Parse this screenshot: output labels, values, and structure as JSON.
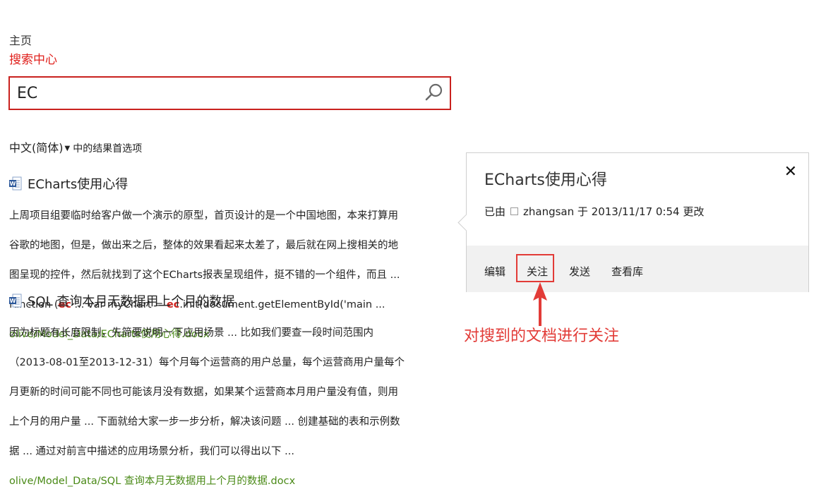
{
  "breadcrumb": {
    "home": "主页",
    "current": "搜索中心"
  },
  "search": {
    "value": "EC"
  },
  "language": {
    "selected": "中文(简体)",
    "suffix": "中的结果首选项"
  },
  "results": [
    {
      "title": "ECharts使用心得",
      "snippet_lines": [
        "上周项目组要临时给客户做一个演示的原型，首页设计的是一个中国地图，本来打算用",
        "谷歌的地图，但是，做出来之后，整体的效果看起来太差了，最后就在网上搜相关的地",
        "图呈现的控件，然后就找到了这个ECharts报表呈现组件，挺不错的一个组件，而且 ..."
      ],
      "code_line": {
        "a": "function (",
        "hl1": "ec",
        "b": " ... var myChart = ",
        "hl2": "ec",
        "c": ".init(document.getElementById('main ..."
      },
      "url": "olive/Model_Data/ECharts使用心得.docx"
    },
    {
      "title": "SQL 查询本月无数据用上个月的数据",
      "snippet_lines": [
        "因为标题有长度限制，先简要说明一下应用场景 ... 比如我们要查一段时间范围内",
        "（2013-08-01至2013-12-31）每个月每个运营商的用户总量，每个运营商用户量每个",
        "月更新的时间可能不同也可能该月没有数据，如果某个运营商本月用户量没有值，则用",
        "上个月的用户量 ... 下面就给大家一步一步分析，解决该问题 ... 创建基础的表和示例数",
        "据 ... 通过对前言中描述的应用场景分析，我们可以得出以下 ..."
      ],
      "url": "olive/Model_Data/SQL 查询本月无数据用上个月的数据.docx"
    }
  ],
  "callout": {
    "title": "ECharts使用心得",
    "close": "✕",
    "meta_prefix": "已由",
    "meta_user": "zhangsan 于 2013/11/17 0:54 更改",
    "actions": {
      "edit": "编辑",
      "follow": "关注",
      "send": "发送",
      "library": "查看库"
    }
  },
  "annotation": "对搜到的文档进行关注",
  "colors": {
    "accent_red": "#e23b37",
    "url_green": "#4a8a17",
    "highlight": "#d0231f"
  }
}
